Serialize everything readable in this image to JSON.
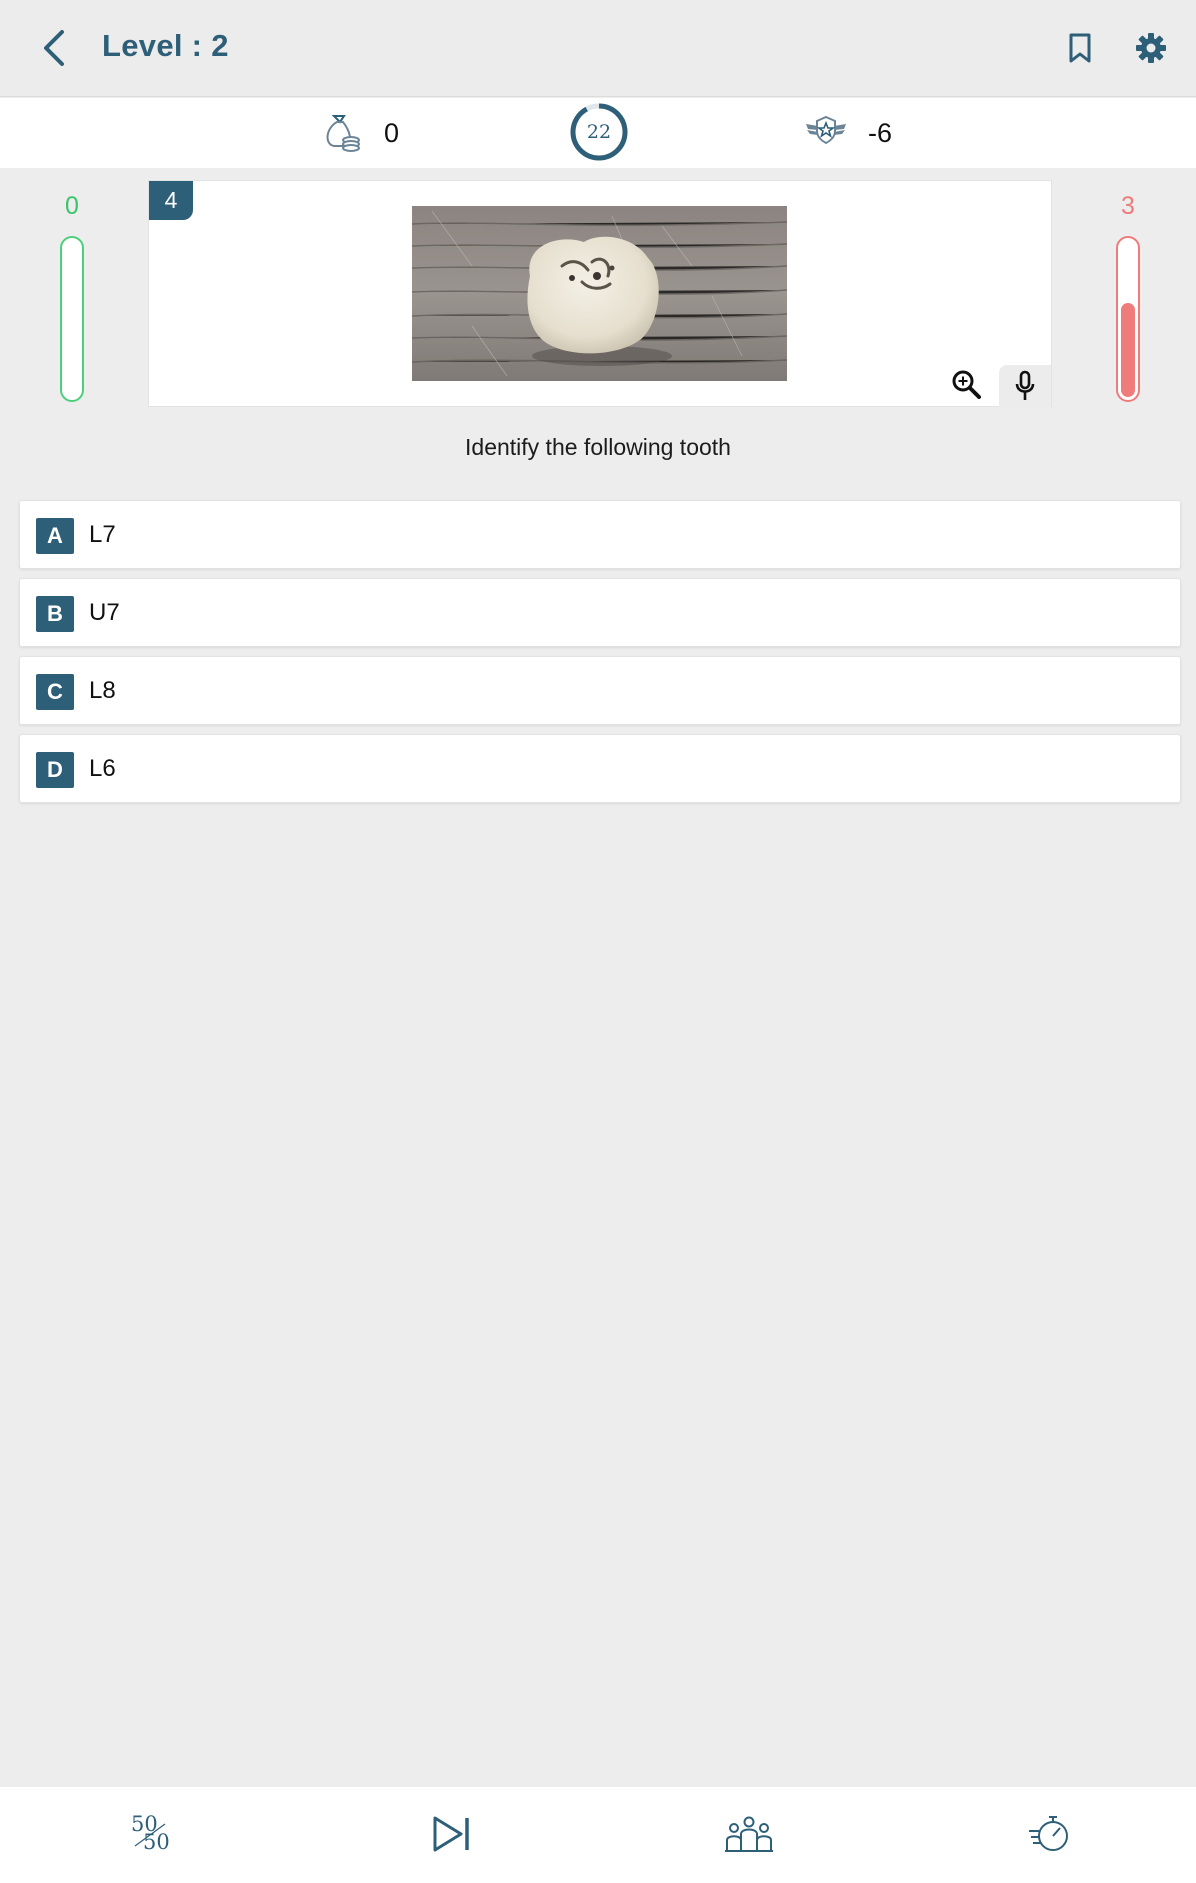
{
  "header": {
    "level_title": "Level : 2",
    "icons": {
      "back": "back-arrow-icon",
      "bookmark": "bookmark-icon",
      "settings": "gear-icon"
    }
  },
  "stats": {
    "coins": "0",
    "timer": "22",
    "timer_progress": 0.92,
    "rank_points": "-6"
  },
  "meters": {
    "correct_count": "0",
    "correct_fill": 0,
    "wrong_count": "3",
    "wrong_fill": 0.6
  },
  "question": {
    "number": "4",
    "image_alt": "Extracted molar tooth on a wooden surface",
    "text": "Identify the following tooth"
  },
  "options": [
    {
      "letter": "A",
      "text": "L7"
    },
    {
      "letter": "B",
      "text": "U7"
    },
    {
      "letter": "C",
      "text": "L8"
    },
    {
      "letter": "D",
      "text": "L6"
    }
  ],
  "lifelines": {
    "fifty_fifty": {
      "top": "50",
      "bottom": "50"
    },
    "icons": [
      "fifty-fifty-icon",
      "skip-icon",
      "audience-poll-icon",
      "extra-time-icon"
    ]
  },
  "colors": {
    "accent": "#2e5f78",
    "correct": "#4ccf7a",
    "wrong": "#ef7b7b",
    "background": "#ededed"
  }
}
